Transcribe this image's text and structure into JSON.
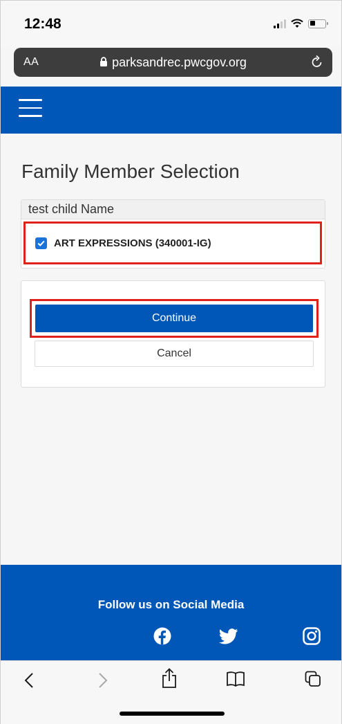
{
  "status_bar": {
    "time": "12:48"
  },
  "browser": {
    "text_size_label": "AA",
    "url": "parksandrec.pwcgov.org"
  },
  "page": {
    "title": "Family Member Selection",
    "member_name": "test child Name",
    "activity": {
      "label": "ART EXPRESSIONS (340001-IG)",
      "checked": true
    },
    "continue_label": "Continue",
    "cancel_label": "Cancel"
  },
  "footer": {
    "title": "Follow us on Social Media",
    "social": [
      "facebook-icon",
      "twitter-icon",
      "instagram-icon"
    ]
  },
  "colors": {
    "brand_blue": "#0057b8",
    "highlight_red": "#e0201b",
    "checkbox_blue": "#1a73d9"
  }
}
